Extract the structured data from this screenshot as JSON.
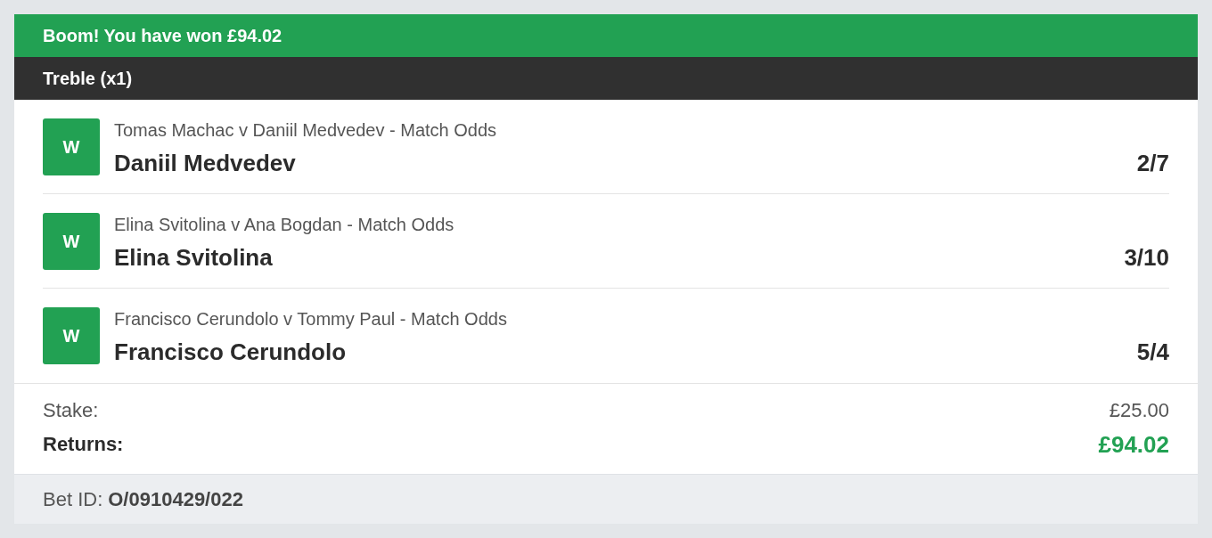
{
  "banner": {
    "title": "Boom! You have won £94.02"
  },
  "bet": {
    "title": "Treble (x1)"
  },
  "selections": [
    {
      "result": "W",
      "event": "Tomas Machac v Daniil Medvedev - Match Odds",
      "selection": "Daniil Medvedev",
      "odds": "2/7"
    },
    {
      "result": "W",
      "event": "Elina Svitolina v Ana Bogdan - Match Odds",
      "selection": "Elina Svitolina",
      "odds": "3/10"
    },
    {
      "result": "W",
      "event": "Francisco Cerundolo v Tommy Paul - Match Odds",
      "selection": "Francisco Cerundolo",
      "odds": "5/4"
    }
  ],
  "summary": {
    "stake_label": "Stake:",
    "stake": "£25.00",
    "returns_label": "Returns:",
    "returns": "£94.02"
  },
  "footer": {
    "bet_id_label": "Bet ID:",
    "bet_id": "O/0910429/022"
  }
}
